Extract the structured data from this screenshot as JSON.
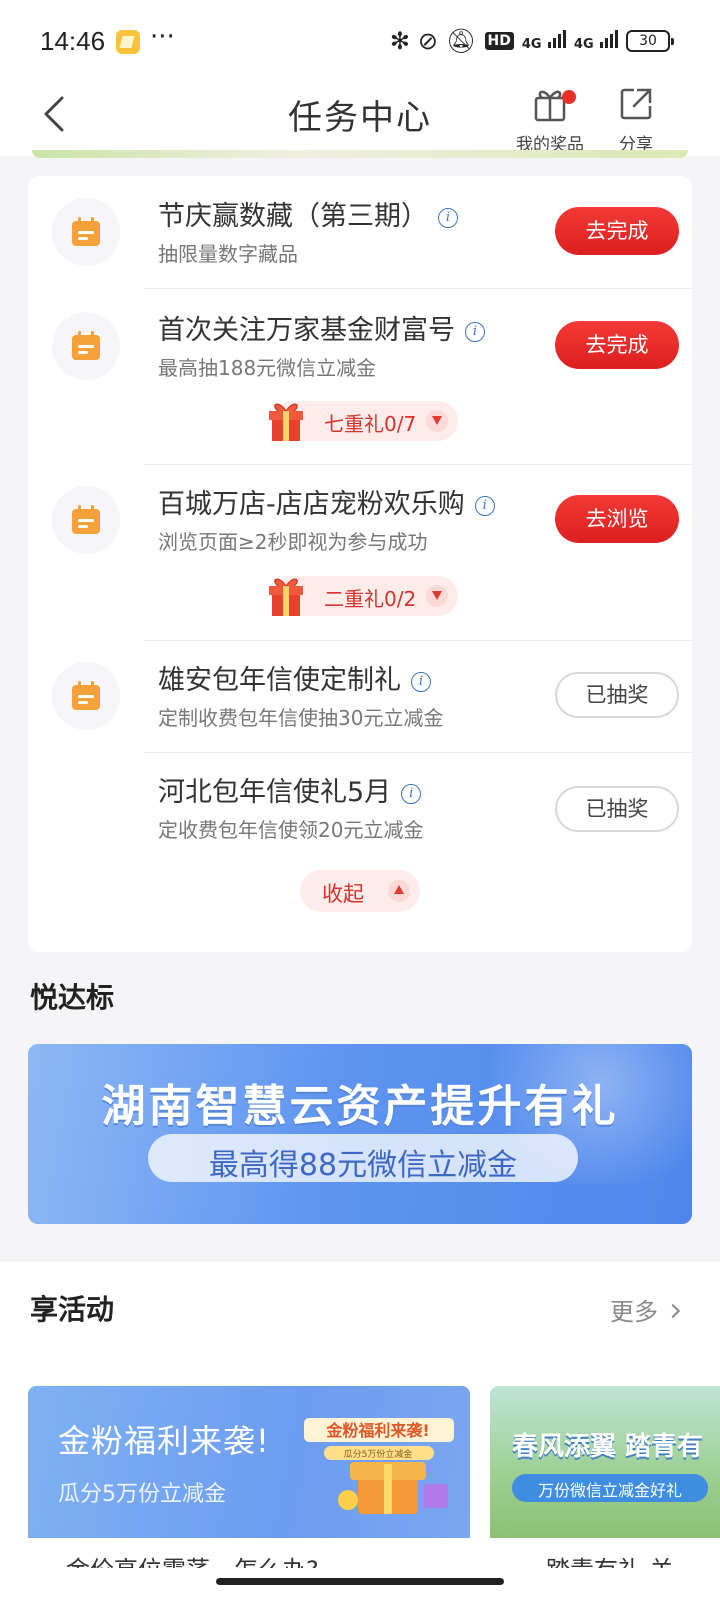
{
  "status_bar": {
    "time": "14:46",
    "more": "···",
    "hd_label": "HD",
    "sig1_label": "4G",
    "sig2_label": "4G",
    "battery": "30"
  },
  "nav": {
    "title": "任务中心",
    "my_prizes": "我的奖品",
    "share": "分享"
  },
  "tasks": [
    {
      "title": "节庆赢数藏（第三期）",
      "subtitle": "抽限量数字藏品",
      "action": "去完成",
      "action_state": "active"
    },
    {
      "title": "首次关注万家基金财富号",
      "subtitle": "最高抽188元微信立减金",
      "action": "去完成",
      "action_state": "active",
      "gift": "七重礼0/7"
    },
    {
      "title": "百城万店-店店宠粉欢乐购",
      "subtitle": "浏览页面≥2秒即视为参与成功",
      "action": "去浏览",
      "action_state": "active",
      "gift": "二重礼0/2"
    },
    {
      "title": "雄安包年信使定制礼",
      "subtitle": "定制收费包年信使抽30元立减金",
      "action": "已抽奖",
      "action_state": "done"
    },
    {
      "title": "河北包年信使礼5月",
      "subtitle": "定收费包年信使领20元立减金",
      "action": "已抽奖",
      "action_state": "done"
    }
  ],
  "collapse_label": "收起",
  "yueda": {
    "heading": "悦达标",
    "banner_title": "湖南智慧云资产提升有礼",
    "banner_subtitle": "最高得88元微信立减金"
  },
  "activities": {
    "heading": "享活动",
    "more": "更多",
    "card1": {
      "title": "金粉福利来袭!",
      "subtitle": "瓜分5万份立减金",
      "sticker_title": "金粉福利来袭!",
      "sticker_sub": "瓜分5万份立减金",
      "caption": "金价高位震荡，怎么办?"
    },
    "card2": {
      "title": "春风添翼 踏青有",
      "subtitle": "万份微信立减金好礼",
      "caption": "踏青有礼 关"
    }
  },
  "colors": {
    "accent_red": "#e8302b",
    "icon_orange": "#f5a13a",
    "info_blue": "#3a74c7"
  }
}
